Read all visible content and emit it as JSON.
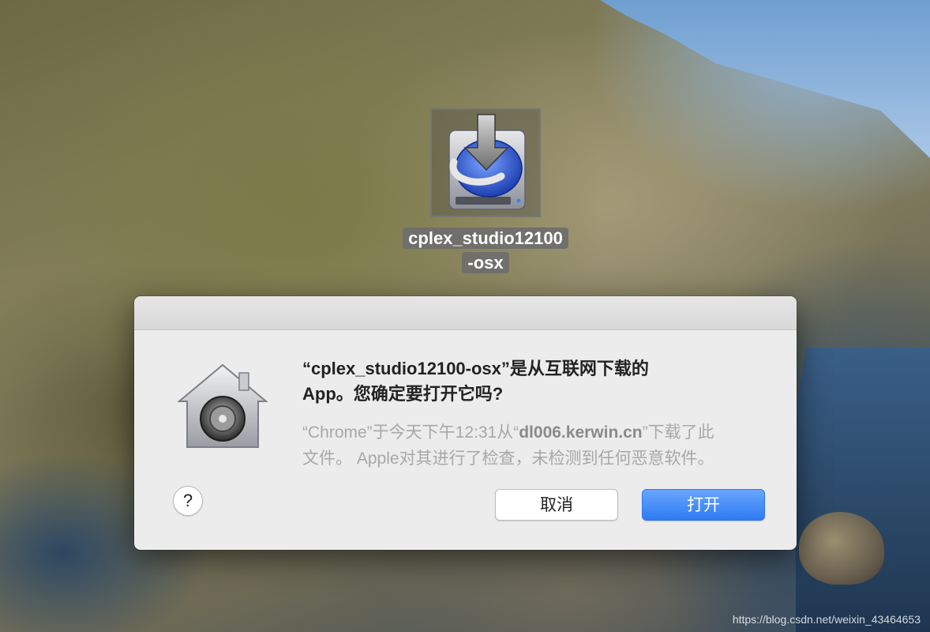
{
  "desktop": {
    "icon_label_line1": "cplex_studio12100",
    "icon_label_line2": "-osx",
    "icon": "installer-disk-icon"
  },
  "dialog": {
    "title_line1": "“cplex_studio12100-osx”是从互联网下载的",
    "title_line2": "App。您确定要打开它吗?",
    "info_prefix": "“Chrome”于今天下午12:31从“",
    "info_domain": "dl006.kerwin.cn",
    "info_suffix": "”下载了此",
    "info_line2": "文件。 Apple对其进行了检查，未检测到任何恶意软件。",
    "help_label": "?",
    "cancel_label": "取消",
    "open_label": "打开",
    "icon": "gatekeeper-lock-icon"
  },
  "watermark": "https://blog.csdn.net/weixin_43464653",
  "colors": {
    "primary_button": "#2e7bf3",
    "dialog_bg": "#ececec"
  }
}
